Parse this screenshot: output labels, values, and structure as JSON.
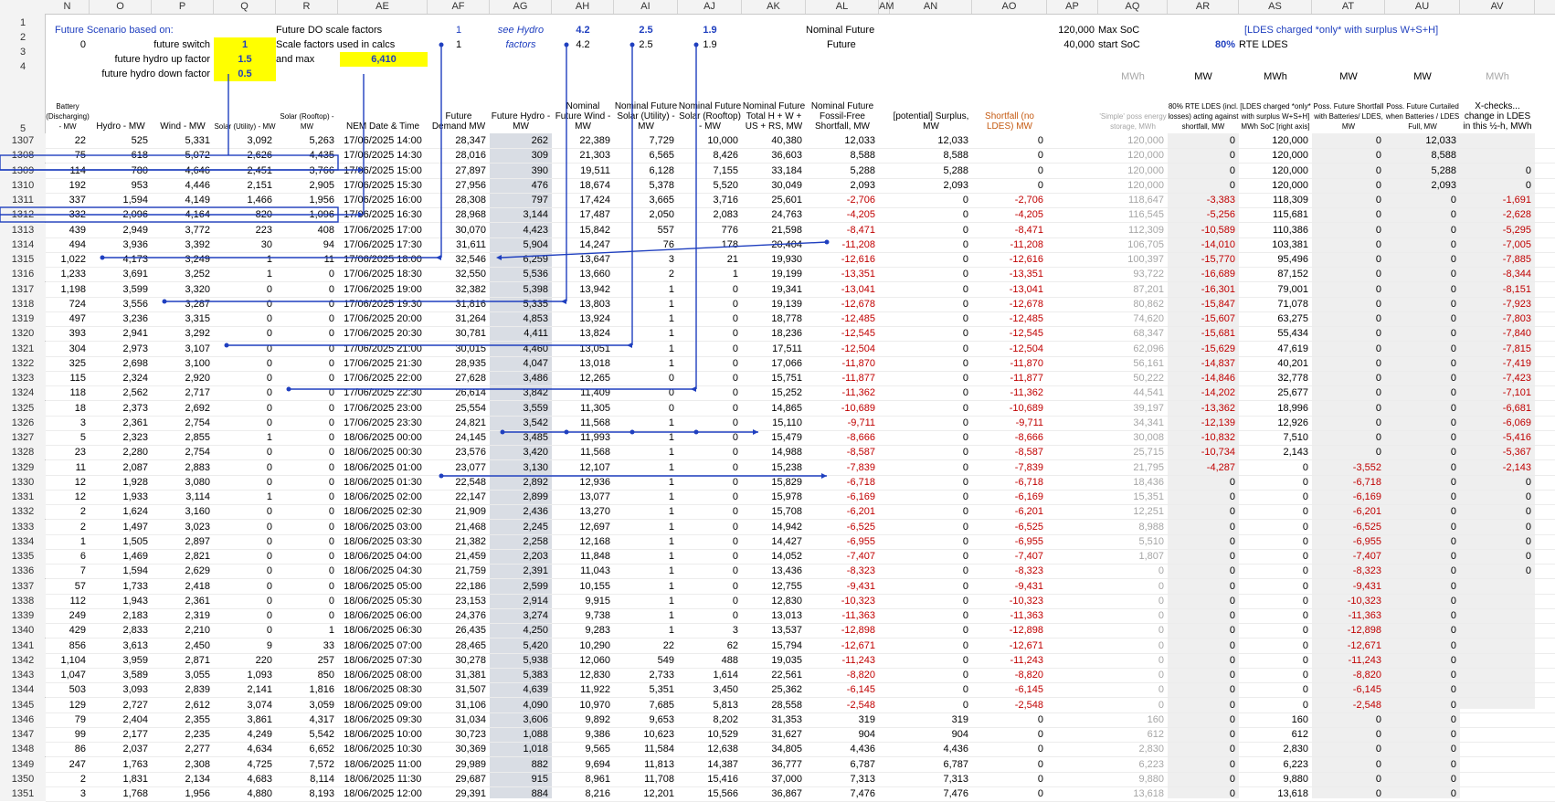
{
  "columns": [
    "N",
    "O",
    "P",
    "Q",
    "R",
    "AE",
    "AF",
    "AG",
    "AH",
    "AI",
    "AJ",
    "AK",
    "AL",
    "AM",
    "AN",
    "AO",
    "AP",
    "AQ",
    "AR",
    "AS",
    "AT",
    "AU",
    "AV"
  ],
  "top": {
    "r1": {
      "label": "Future Scenario based on:",
      "q": "",
      "r": "Future DO scale factors",
      "af": "1",
      "ag": "see Hydro",
      "ah": "4.2",
      "ai": "2.5",
      "aj": "1.9",
      "al": "Nominal Future",
      "ap": "120,000",
      "aq": "Max SoC",
      "as": "[LDES charged *only* with surplus W+S+H]"
    },
    "r2": {
      "n": "0",
      "label": "future switch",
      "q": "1",
      "r": "Scale factors used in calcs",
      "af": "1",
      "ag": "factors",
      "ah": "4.2",
      "ai": "2.5",
      "aj": "1.9",
      "al": "Future",
      "ap": "40,000",
      "aq": "start SoC",
      "ar": "80%",
      "as": "RTE LDES"
    },
    "r3": {
      "label": "future hydro up factor",
      "q": "1.5",
      "r": "and max",
      "ae": "6,410"
    },
    "r4": {
      "label": "future hydro down factor",
      "q": "0.5",
      "aq": "MWh",
      "ar": "MW",
      "as": "MWh",
      "at": "MW",
      "au": "MW",
      "av": "MWh"
    }
  },
  "headers": {
    "N": "Battery (Discharging) - MW",
    "O": "Hydro - MW",
    "P": "Wind - MW",
    "Q": "Solar (Utility) - MW",
    "R": "Solar (Rooftop) - MW",
    "AE": "NEM Date & Time",
    "AF": "Future Demand MW",
    "AG": "Future Hydro - MW",
    "AH": "Nominal Future Wind - MW",
    "AI": "Nominal Future Solar (Utility) - MW",
    "AJ": "Nominal Future Solar (Rooftop) - MW",
    "AK": "Nominal Future Total H + W + US + RS, MW",
    "AL": "Nominal Future Fossil-Free Shortfall, MW",
    "AN": "[potential] Surplus, MW",
    "AO": "Shortfall (no LDES) MW",
    "AQ": "'Simple' poss energy storage, MWh",
    "AR": "80% RTE LDES (incl. losses) acting against shortfall, MW",
    "AS": "[LDES charged *only* with surplus W+S+H] MWh SoC [right axis]",
    "AT": "Poss. Future Shortfall with Batteries/ LDES, MW",
    "AU": "Poss. Future Curtailed when Batteries / LDES Full, MW",
    "AV": "X-checks... change in LDES in this ½-h, MWh"
  },
  "rows": [
    [
      "1307",
      "22",
      "525",
      "5,331",
      "3,092",
      "5,263",
      "17/06/2025 14:00",
      "28,347",
      "262",
      "22,389",
      "7,729",
      "10,000",
      "40,380",
      "12,033",
      "12,033",
      "0",
      "120,000",
      "0",
      "120,000",
      "0",
      "12,033",
      ""
    ],
    [
      "1308",
      "75",
      "618",
      "5,072",
      "2,626",
      "4,435",
      "17/06/2025 14:30",
      "28,016",
      "309",
      "21,303",
      "6,565",
      "8,426",
      "36,603",
      "8,588",
      "8,588",
      "0",
      "120,000",
      "0",
      "120,000",
      "0",
      "8,588",
      ""
    ],
    [
      "1309",
      "114",
      "780",
      "4,646",
      "2,451",
      "3,766",
      "17/06/2025 15:00",
      "27,897",
      "390",
      "19,511",
      "6,128",
      "7,155",
      "33,184",
      "5,288",
      "5,288",
      "0",
      "120,000",
      "0",
      "120,000",
      "0",
      "5,288",
      "0"
    ],
    [
      "1310",
      "192",
      "953",
      "4,446",
      "2,151",
      "2,905",
      "17/06/2025 15:30",
      "27,956",
      "476",
      "18,674",
      "5,378",
      "5,520",
      "30,049",
      "2,093",
      "2,093",
      "0",
      "120,000",
      "0",
      "120,000",
      "0",
      "2,093",
      "0"
    ],
    [
      "1311",
      "337",
      "1,594",
      "4,149",
      "1,466",
      "1,956",
      "17/06/2025 16:00",
      "28,308",
      "797",
      "17,424",
      "3,665",
      "3,716",
      "25,601",
      "-2,706",
      "0",
      "-2,706",
      "118,647",
      "-3,383",
      "118,309",
      "0",
      "0",
      "-1,691"
    ],
    [
      "1312",
      "332",
      "2,096",
      "4,164",
      "820",
      "1,096",
      "17/06/2025 16:30",
      "28,968",
      "3,144",
      "17,487",
      "2,050",
      "2,083",
      "24,763",
      "-4,205",
      "0",
      "-4,205",
      "116,545",
      "-5,256",
      "115,681",
      "0",
      "0",
      "-2,628"
    ],
    [
      "1313",
      "439",
      "2,949",
      "3,772",
      "223",
      "408",
      "17/06/2025 17:00",
      "30,070",
      "4,423",
      "15,842",
      "557",
      "776",
      "21,598",
      "-8,471",
      "0",
      "-8,471",
      "112,309",
      "-10,589",
      "110,386",
      "0",
      "0",
      "-5,295"
    ],
    [
      "1314",
      "494",
      "3,936",
      "3,392",
      "30",
      "94",
      "17/06/2025 17:30",
      "31,611",
      "5,904",
      "14,247",
      "76",
      "178",
      "20,404",
      "-11,208",
      "0",
      "-11,208",
      "106,705",
      "-14,010",
      "103,381",
      "0",
      "0",
      "-7,005"
    ],
    [
      "1315",
      "1,022",
      "4,173",
      "3,249",
      "1",
      "11",
      "17/06/2025 18:00",
      "32,546",
      "6,259",
      "13,647",
      "3",
      "21",
      "19,930",
      "-12,616",
      "0",
      "-12,616",
      "100,397",
      "-15,770",
      "95,496",
      "0",
      "0",
      "-7,885"
    ],
    [
      "1316",
      "1,233",
      "3,691",
      "3,252",
      "1",
      "0",
      "17/06/2025 18:30",
      "32,550",
      "5,536",
      "13,660",
      "2",
      "1",
      "19,199",
      "-13,351",
      "0",
      "-13,351",
      "93,722",
      "-16,689",
      "87,152",
      "0",
      "0",
      "-8,344"
    ],
    [
      "1317",
      "1,198",
      "3,599",
      "3,320",
      "0",
      "0",
      "17/06/2025 19:00",
      "32,382",
      "5,398",
      "13,942",
      "1",
      "0",
      "19,341",
      "-13,041",
      "0",
      "-13,041",
      "87,201",
      "-16,301",
      "79,001",
      "0",
      "0",
      "-8,151"
    ],
    [
      "1318",
      "724",
      "3,556",
      "3,287",
      "0",
      "0",
      "17/06/2025 19:30",
      "31,816",
      "5,335",
      "13,803",
      "1",
      "0",
      "19,139",
      "-12,678",
      "0",
      "-12,678",
      "80,862",
      "-15,847",
      "71,078",
      "0",
      "0",
      "-7,923"
    ],
    [
      "1319",
      "497",
      "3,236",
      "3,315",
      "0",
      "0",
      "17/06/2025 20:00",
      "31,264",
      "4,853",
      "13,924",
      "1",
      "0",
      "18,778",
      "-12,485",
      "0",
      "-12,485",
      "74,620",
      "-15,607",
      "63,275",
      "0",
      "0",
      "-7,803"
    ],
    [
      "1320",
      "393",
      "2,941",
      "3,292",
      "0",
      "0",
      "17/06/2025 20:30",
      "30,781",
      "4,411",
      "13,824",
      "1",
      "0",
      "18,236",
      "-12,545",
      "0",
      "-12,545",
      "68,347",
      "-15,681",
      "55,434",
      "0",
      "0",
      "-7,840"
    ],
    [
      "1321",
      "304",
      "2,973",
      "3,107",
      "0",
      "0",
      "17/06/2025 21:00",
      "30,015",
      "4,460",
      "13,051",
      "1",
      "0",
      "17,511",
      "-12,504",
      "0",
      "-12,504",
      "62,096",
      "-15,629",
      "47,619",
      "0",
      "0",
      "-7,815"
    ],
    [
      "1322",
      "325",
      "2,698",
      "3,100",
      "0",
      "0",
      "17/06/2025 21:30",
      "28,935",
      "4,047",
      "13,018",
      "1",
      "0",
      "17,066",
      "-11,870",
      "0",
      "-11,870",
      "56,161",
      "-14,837",
      "40,201",
      "0",
      "0",
      "-7,419"
    ],
    [
      "1323",
      "115",
      "2,324",
      "2,920",
      "0",
      "0",
      "17/06/2025 22:00",
      "27,628",
      "3,486",
      "12,265",
      "0",
      "0",
      "15,751",
      "-11,877",
      "0",
      "-11,877",
      "50,222",
      "-14,846",
      "32,778",
      "0",
      "0",
      "-7,423"
    ],
    [
      "1324",
      "118",
      "2,562",
      "2,717",
      "0",
      "0",
      "17/06/2025 22:30",
      "26,614",
      "3,842",
      "11,409",
      "0",
      "0",
      "15,252",
      "-11,362",
      "0",
      "-11,362",
      "44,541",
      "-14,202",
      "25,677",
      "0",
      "0",
      "-7,101"
    ],
    [
      "1325",
      "18",
      "2,373",
      "2,692",
      "0",
      "0",
      "17/06/2025 23:00",
      "25,554",
      "3,559",
      "11,305",
      "0",
      "0",
      "14,865",
      "-10,689",
      "0",
      "-10,689",
      "39,197",
      "-13,362",
      "18,996",
      "0",
      "0",
      "-6,681"
    ],
    [
      "1326",
      "3",
      "2,361",
      "2,754",
      "0",
      "0",
      "17/06/2025 23:30",
      "24,821",
      "3,542",
      "11,568",
      "1",
      "0",
      "15,110",
      "-9,711",
      "0",
      "-9,711",
      "34,341",
      "-12,139",
      "12,926",
      "0",
      "0",
      "-6,069"
    ],
    [
      "1327",
      "5",
      "2,323",
      "2,855",
      "1",
      "0",
      "18/06/2025 00:00",
      "24,145",
      "3,485",
      "11,993",
      "1",
      "0",
      "15,479",
      "-8,666",
      "0",
      "-8,666",
      "30,008",
      "-10,832",
      "7,510",
      "0",
      "0",
      "-5,416"
    ],
    [
      "1328",
      "23",
      "2,280",
      "2,754",
      "0",
      "0",
      "18/06/2025 00:30",
      "23,576",
      "3,420",
      "11,568",
      "1",
      "0",
      "14,988",
      "-8,587",
      "0",
      "-8,587",
      "25,715",
      "-10,734",
      "2,143",
      "0",
      "0",
      "-5,367"
    ],
    [
      "1329",
      "11",
      "2,087",
      "2,883",
      "0",
      "0",
      "18/06/2025 01:00",
      "23,077",
      "3,130",
      "12,107",
      "1",
      "0",
      "15,238",
      "-7,839",
      "0",
      "-7,839",
      "21,795",
      "-4,287",
      "0",
      "-3,552",
      "0",
      "-2,143"
    ],
    [
      "1330",
      "12",
      "1,928",
      "3,080",
      "0",
      "0",
      "18/06/2025 01:30",
      "22,548",
      "2,892",
      "12,936",
      "1",
      "0",
      "15,829",
      "-6,718",
      "0",
      "-6,718",
      "18,436",
      "0",
      "0",
      "-6,718",
      "0",
      "0"
    ],
    [
      "1331",
      "12",
      "1,933",
      "3,114",
      "1",
      "0",
      "18/06/2025 02:00",
      "22,147",
      "2,899",
      "13,077",
      "1",
      "0",
      "15,978",
      "-6,169",
      "0",
      "-6,169",
      "15,351",
      "0",
      "0",
      "-6,169",
      "0",
      "0"
    ],
    [
      "1332",
      "2",
      "1,624",
      "3,160",
      "0",
      "0",
      "18/06/2025 02:30",
      "21,909",
      "2,436",
      "13,270",
      "1",
      "0",
      "15,708",
      "-6,201",
      "0",
      "-6,201",
      "12,251",
      "0",
      "0",
      "-6,201",
      "0",
      "0"
    ],
    [
      "1333",
      "2",
      "1,497",
      "3,023",
      "0",
      "0",
      "18/06/2025 03:00",
      "21,468",
      "2,245",
      "12,697",
      "1",
      "0",
      "14,942",
      "-6,525",
      "0",
      "-6,525",
      "8,988",
      "0",
      "0",
      "-6,525",
      "0",
      "0"
    ],
    [
      "1334",
      "1",
      "1,505",
      "2,897",
      "0",
      "0",
      "18/06/2025 03:30",
      "21,382",
      "2,258",
      "12,168",
      "1",
      "0",
      "14,427",
      "-6,955",
      "0",
      "-6,955",
      "5,510",
      "0",
      "0",
      "-6,955",
      "0",
      "0"
    ],
    [
      "1335",
      "6",
      "1,469",
      "2,821",
      "0",
      "0",
      "18/06/2025 04:00",
      "21,459",
      "2,203",
      "11,848",
      "1",
      "0",
      "14,052",
      "-7,407",
      "0",
      "-7,407",
      "1,807",
      "0",
      "0",
      "-7,407",
      "0",
      "0"
    ],
    [
      "1336",
      "7",
      "1,594",
      "2,629",
      "0",
      "0",
      "18/06/2025 04:30",
      "21,759",
      "2,391",
      "11,043",
      "1",
      "0",
      "13,436",
      "-8,323",
      "0",
      "-8,323",
      "0",
      "0",
      "0",
      "-8,323",
      "0",
      "0"
    ],
    [
      "1337",
      "57",
      "1,733",
      "2,418",
      "0",
      "0",
      "18/06/2025 05:00",
      "22,186",
      "2,599",
      "10,155",
      "1",
      "0",
      "12,755",
      "-9,431",
      "0",
      "-9,431",
      "0",
      "0",
      "0",
      "-9,431",
      "0",
      ""
    ],
    [
      "1338",
      "112",
      "1,943",
      "2,361",
      "0",
      "0",
      "18/06/2025 05:30",
      "23,153",
      "2,914",
      "9,915",
      "1",
      "0",
      "12,830",
      "-10,323",
      "0",
      "-10,323",
      "0",
      "0",
      "0",
      "-10,323",
      "0",
      ""
    ],
    [
      "1339",
      "249",
      "2,183",
      "2,319",
      "0",
      "0",
      "18/06/2025 06:00",
      "24,376",
      "3,274",
      "9,738",
      "1",
      "0",
      "13,013",
      "-11,363",
      "0",
      "-11,363",
      "0",
      "0",
      "0",
      "-11,363",
      "0",
      ""
    ],
    [
      "1340",
      "429",
      "2,833",
      "2,210",
      "0",
      "1",
      "18/06/2025 06:30",
      "26,435",
      "4,250",
      "9,283",
      "1",
      "3",
      "13,537",
      "-12,898",
      "0",
      "-12,898",
      "0",
      "0",
      "0",
      "-12,898",
      "0",
      ""
    ],
    [
      "1341",
      "856",
      "3,613",
      "2,450",
      "9",
      "33",
      "18/06/2025 07:00",
      "28,465",
      "5,420",
      "10,290",
      "22",
      "62",
      "15,794",
      "-12,671",
      "0",
      "-12,671",
      "0",
      "0",
      "0",
      "-12,671",
      "0",
      ""
    ],
    [
      "1342",
      "1,104",
      "3,959",
      "2,871",
      "220",
      "257",
      "18/06/2025 07:30",
      "30,278",
      "5,938",
      "12,060",
      "549",
      "488",
      "19,035",
      "-11,243",
      "0",
      "-11,243",
      "0",
      "0",
      "0",
      "-11,243",
      "0",
      ""
    ],
    [
      "1343",
      "1,047",
      "3,589",
      "3,055",
      "1,093",
      "850",
      "18/06/2025 08:00",
      "31,381",
      "5,383",
      "12,830",
      "2,733",
      "1,614",
      "22,561",
      "-8,820",
      "0",
      "-8,820",
      "0",
      "0",
      "0",
      "-8,820",
      "0",
      ""
    ],
    [
      "1344",
      "503",
      "3,093",
      "2,839",
      "2,141",
      "1,816",
      "18/06/2025 08:30",
      "31,507",
      "4,639",
      "11,922",
      "5,351",
      "3,450",
      "25,362",
      "-6,145",
      "0",
      "-6,145",
      "0",
      "0",
      "0",
      "-6,145",
      "0",
      ""
    ],
    [
      "1345",
      "129",
      "2,727",
      "2,612",
      "3,074",
      "3,059",
      "18/06/2025 09:00",
      "31,106",
      "4,090",
      "10,970",
      "7,685",
      "5,813",
      "28,558",
      "-2,548",
      "0",
      "-2,548",
      "0",
      "0",
      "0",
      "-2,548",
      "0",
      ""
    ],
    [
      "1346",
      "79",
      "2,404",
      "2,355",
      "3,861",
      "4,317",
      "18/06/2025 09:30",
      "31,034",
      "3,606",
      "9,892",
      "9,653",
      "8,202",
      "31,353",
      "319",
      "319",
      "0",
      "160",
      "0",
      "160",
      "0",
      "0",
      ""
    ],
    [
      "1347",
      "99",
      "2,177",
      "2,235",
      "4,249",
      "5,542",
      "18/06/2025 10:00",
      "30,723",
      "1,088",
      "9,386",
      "10,623",
      "10,529",
      "31,627",
      "904",
      "904",
      "0",
      "612",
      "0",
      "612",
      "0",
      "0",
      ""
    ],
    [
      "1348",
      "86",
      "2,037",
      "2,277",
      "4,634",
      "6,652",
      "18/06/2025 10:30",
      "30,369",
      "1,018",
      "9,565",
      "11,584",
      "12,638",
      "34,805",
      "4,436",
      "4,436",
      "0",
      "2,830",
      "0",
      "2,830",
      "0",
      "0",
      ""
    ],
    [
      "1349",
      "247",
      "1,763",
      "2,308",
      "4,725",
      "7,572",
      "18/06/2025 11:00",
      "29,989",
      "882",
      "9,694",
      "11,813",
      "14,387",
      "36,777",
      "6,787",
      "6,787",
      "0",
      "6,223",
      "0",
      "6,223",
      "0",
      "0",
      ""
    ],
    [
      "1350",
      "2",
      "1,831",
      "2,134",
      "4,683",
      "8,114",
      "18/06/2025 11:30",
      "29,687",
      "915",
      "8,961",
      "11,708",
      "15,416",
      "37,000",
      "7,313",
      "7,313",
      "0",
      "9,880",
      "0",
      "9,880",
      "0",
      "0",
      ""
    ],
    [
      "1351",
      "3",
      "1,768",
      "1,956",
      "4,880",
      "8,193",
      "18/06/2025 12:00",
      "29,391",
      "884",
      "8,216",
      "12,201",
      "15,566",
      "36,867",
      "7,476",
      "7,476",
      "0",
      "13,618",
      "0",
      "13,618",
      "0",
      "0",
      ""
    ]
  ]
}
